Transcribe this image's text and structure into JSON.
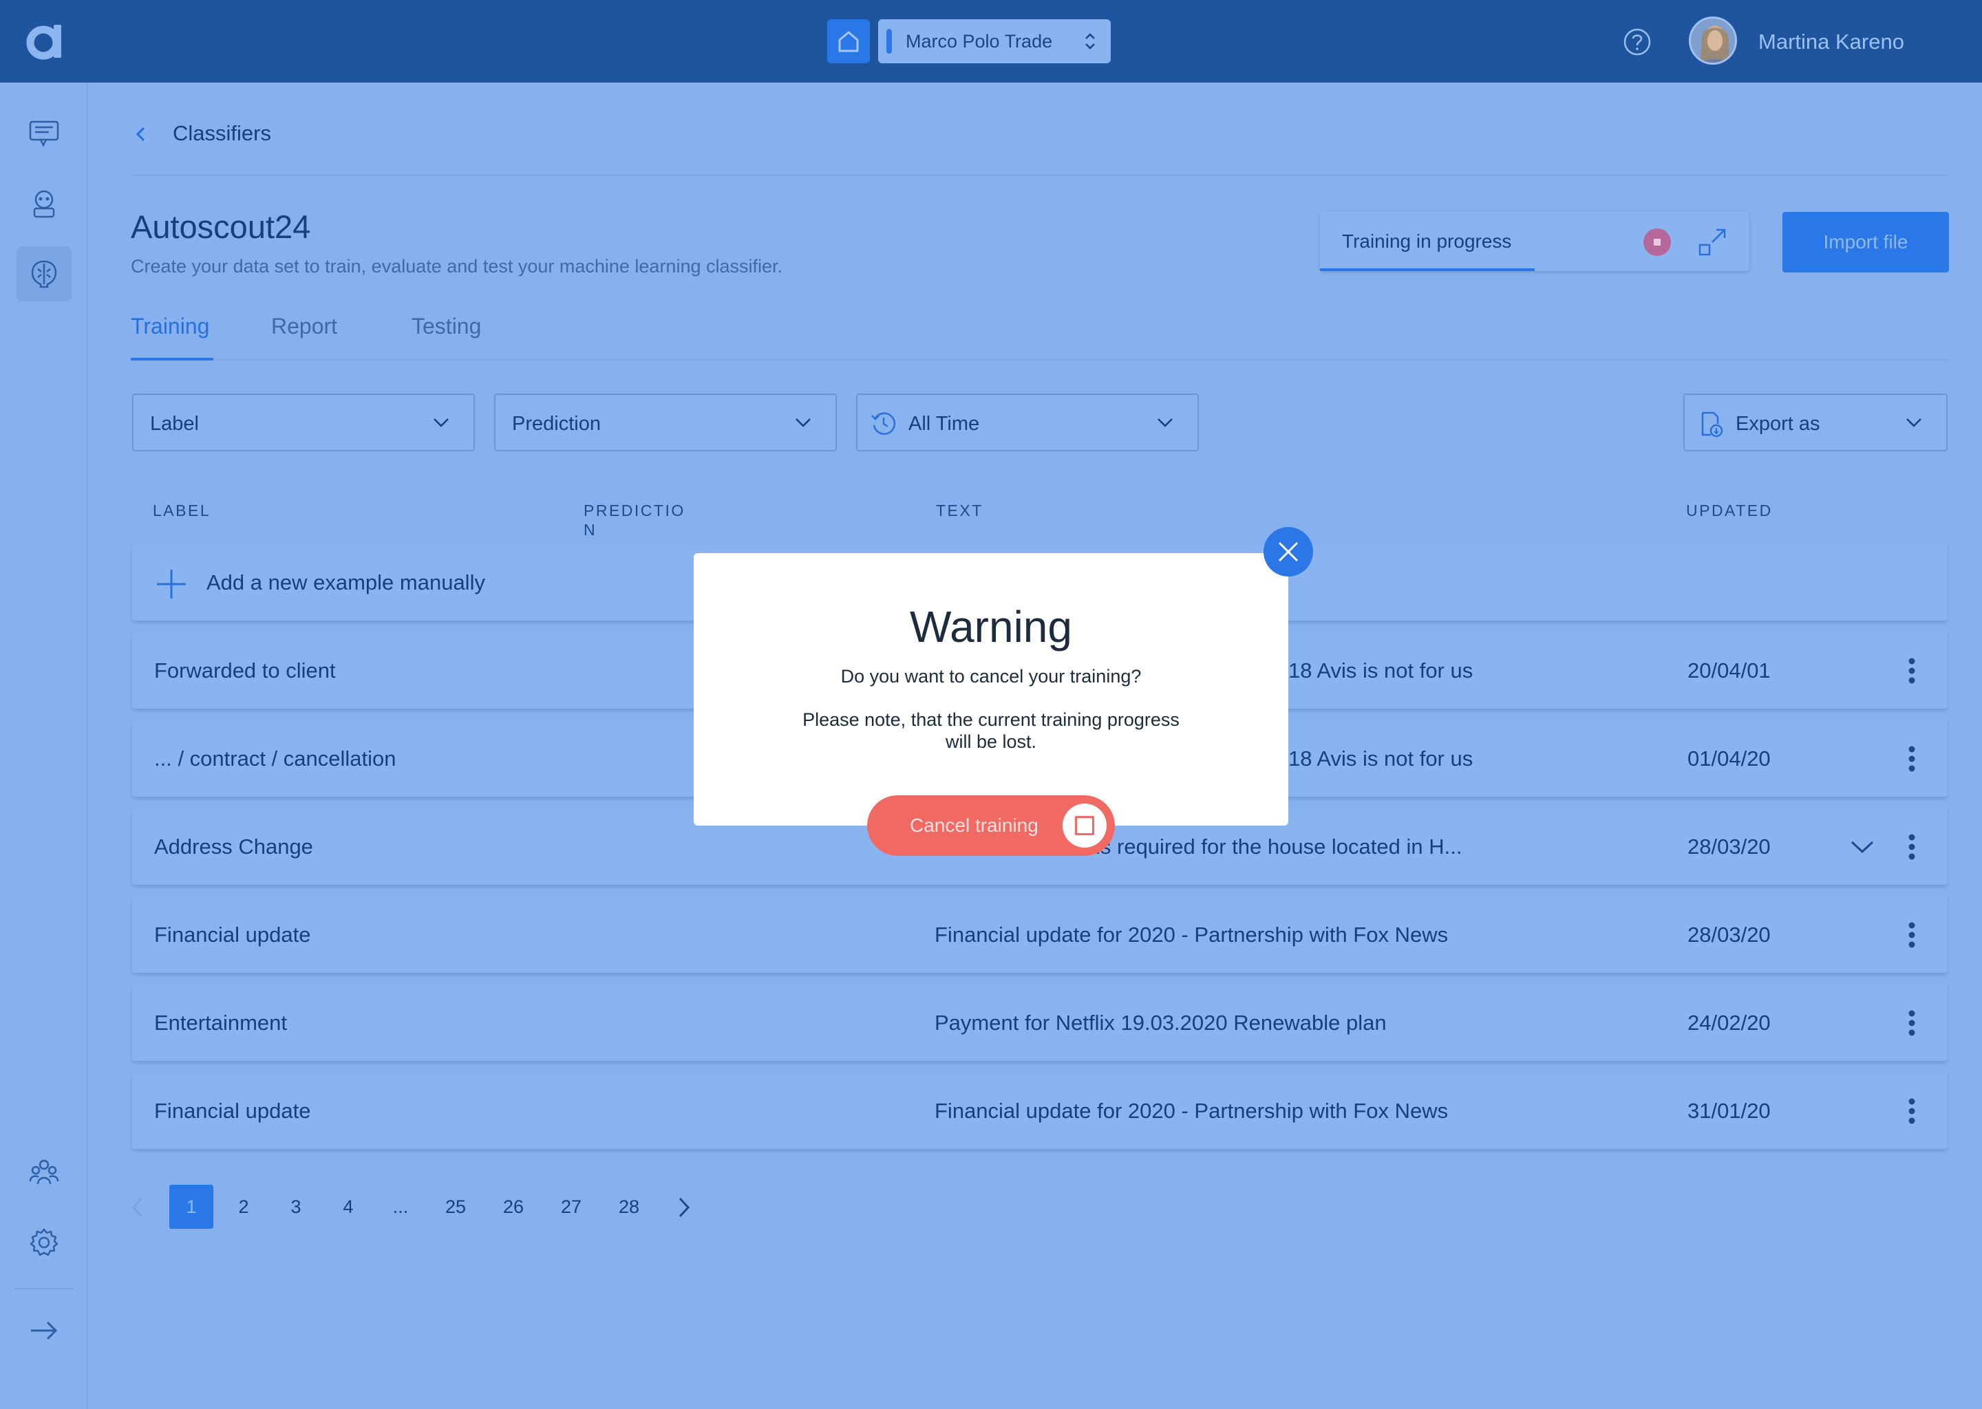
{
  "header": {
    "logo": "a-logo-icon",
    "organization": "Marco Polo Trade",
    "user_name": "Martina Kareno"
  },
  "sidebar": {
    "items": [
      {
        "icon": "messages-icon"
      },
      {
        "icon": "bot-icon"
      },
      {
        "icon": "brain-icon",
        "active": true
      },
      {
        "icon": "team-icon"
      },
      {
        "icon": "gear-icon"
      },
      {
        "icon": "arrow-right-icon"
      }
    ]
  },
  "breadcrumb": {
    "label": "Classifiers"
  },
  "page": {
    "title": "Autoscout24",
    "subtitle": "Create your data set to train, evaluate and test your machine learning classifier."
  },
  "training_status": {
    "label": "Training in progress",
    "progress": 0.5
  },
  "import_label": "Import file",
  "tabs": [
    {
      "label": "Training",
      "active": true
    },
    {
      "label": "Report"
    },
    {
      "label": "Testing"
    }
  ],
  "filters": {
    "label": "Label",
    "prediction": "Prediction",
    "time": "All Time",
    "export": "Export as"
  },
  "table": {
    "columns": {
      "label": "LABEL",
      "prediction_1": "PREDICTIO",
      "prediction_2": "N",
      "text": "TEXT",
      "updated": "UPDATED"
    },
    "add_row": "Add a new example manually",
    "rows": [
      {
        "label": "Forwarded to client",
        "text": "18 Avis is not for us",
        "updated": "20/04/01"
      },
      {
        "label": "... / contract / cancellation",
        "text": "18 Avis is not for us",
        "updated": "01/04/20"
      },
      {
        "label": "Address Change",
        "text": "is required for the house located in H...",
        "updated": "28/03/20"
      },
      {
        "label": "Financial update",
        "text": "Financial update for 2020 - Partnership with Fox News",
        "updated": "28/03/20"
      },
      {
        "label": "Entertainment",
        "text": "Payment for Netflix 19.03.2020 Renewable plan",
        "updated": "24/02/20"
      },
      {
        "label": "Financial update",
        "text": "Financial update for 2020 - Partnership with Fox News",
        "updated": "31/01/20"
      }
    ]
  },
  "pagination": {
    "pages": [
      "1",
      "2",
      "3",
      "4",
      "...",
      "25",
      "26",
      "27",
      "28"
    ],
    "current": "1"
  },
  "modal": {
    "title": "Warning",
    "question": "Do you want to cancel your training?",
    "note": "Please note, that the current training progress will be lost.",
    "cancel_label": "Cancel training"
  },
  "colors": {
    "topbar": "#1f559f",
    "background": "#86b1ee",
    "accent": "#2a78e8",
    "danger": "#f06a63"
  }
}
